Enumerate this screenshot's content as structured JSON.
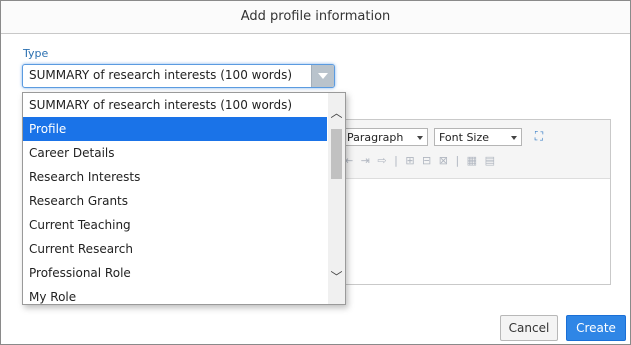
{
  "dialog": {
    "title": "Add profile information",
    "type_label": "Type",
    "type_select": {
      "value": "SUMMARY of research interests (100 words)"
    },
    "dropdown": {
      "options": [
        "SUMMARY of research interests (100 words)",
        "Profile",
        "Career Details",
        "Research Interests",
        "Research Grants",
        "Current Teaching",
        "Current Research",
        "Professional Role",
        "My Role"
      ],
      "highlighted": "Profile"
    },
    "editor": {
      "format_select": "Paragraph",
      "font_size_select": "Font Size"
    },
    "buttons": {
      "cancel": "Cancel",
      "create": "Create"
    }
  },
  "colors": {
    "accent": "#1a73e8",
    "create_button": "#2f86e6"
  }
}
